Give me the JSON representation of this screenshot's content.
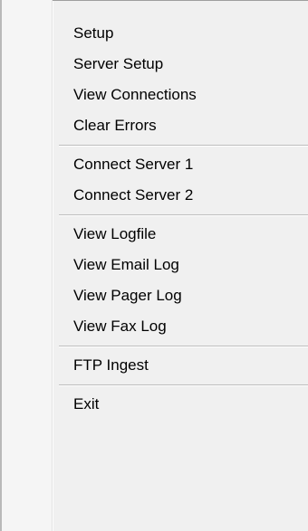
{
  "menu": {
    "groups": [
      [
        "Setup",
        "Server Setup",
        "View Connections",
        "Clear Errors"
      ],
      [
        "Connect Server 1",
        "Connect Server 2"
      ],
      [
        "View Logfile",
        "View Email Log",
        "View Pager Log",
        "View Fax Log"
      ],
      [
        "FTP Ingest"
      ],
      [
        "Exit"
      ]
    ]
  },
  "colors": {
    "background": "#f0f0f0",
    "gutter": "#f5f5f5",
    "text": "#000000",
    "separator": "#bdbdbd"
  }
}
